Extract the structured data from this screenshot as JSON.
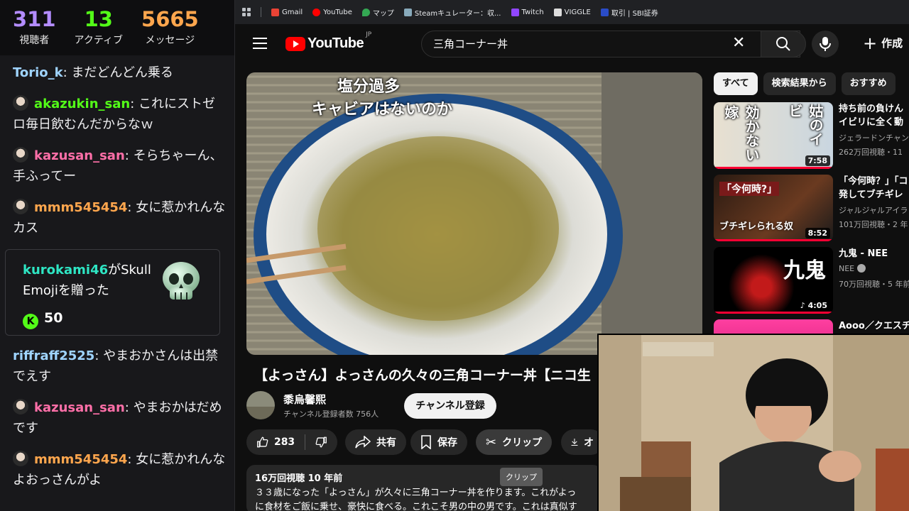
{
  "stream_stats": {
    "viewers": "311",
    "viewers_label": "視聴者",
    "active": "13",
    "active_label": "アクティブ",
    "messages": "5665",
    "messages_label": "メッセージ"
  },
  "chat": {
    "messages": [
      {
        "user": "Torio_k",
        "text": "まだどんどん乗る",
        "color": "#9fd4ff",
        "badge": false
      },
      {
        "user": "akazukin_san",
        "text": "これにストゼロ毎日飲むんだからなｗ",
        "color": "#53fc18",
        "badge": true
      },
      {
        "user": "kazusan_san",
        "text": "そらちゃーん、手ふってー",
        "color": "#ff6fa8",
        "badge": true
      },
      {
        "user": "mmm545454",
        "text": "女に惹かれんなカス",
        "color": "#ffa64d",
        "badge": true
      },
      {
        "user": "riffraff2525",
        "text": "やまおかさんは出禁でえす",
        "color": "#9fd4ff",
        "badge": false
      },
      {
        "user": "kazusan_san",
        "text": "やまおかはだめです",
        "color": "#ff6fa8",
        "badge": true
      },
      {
        "user": "mmm545454",
        "text": "女に惹かれんなよおっさんがよ",
        "color": "#ffa64d",
        "badge": true
      }
    ],
    "gift": {
      "user": "kurokami46",
      "text": "がSkull Emojiを贈った",
      "amount": "50",
      "user_color": "#2ee6c4"
    }
  },
  "bookmarks": [
    {
      "label": "Gmail",
      "color": "#ea4335"
    },
    {
      "label": "YouTube",
      "color": "#ff0000"
    },
    {
      "label": "マップ",
      "color": "#34a853"
    },
    {
      "label": "Steamキュレーター：収...",
      "color": "#9ab"
    },
    {
      "label": "Twitch",
      "color": "#9146ff"
    },
    {
      "label": "VIGGLE",
      "color": "#ddd"
    },
    {
      "label": "取引 | SBI証券",
      "color": "#2a4cc7"
    }
  ],
  "youtube": {
    "logo": "YouTube",
    "region": "JP",
    "search_query": "三角コーナー丼",
    "create_label": "作成",
    "video": {
      "overlay_line1": "塩分過多",
      "overlay_line2": "キャビアはないのか",
      "title": "【よっさん】よっさんの久々の三角コーナー丼【ニコ生",
      "channel": "黍烏馨熙",
      "subscribers": "チャンネル登録者数 756人",
      "subscribe_label": "チャンネル登録",
      "likes": "283",
      "share_label": "共有",
      "save_label": "保存",
      "clip_label": "クリップ",
      "download_label": "オ",
      "tooltip": "クリップ",
      "views_date": "16万回視聴  10 年前",
      "description": "３３歳になった「よっさん」が久々に三角コーナー丼を作ります。これがよっ",
      "description2": "に食材をご飯に乗せ、豪快に食べる。これこそ男の中の男です。これは真似す"
    },
    "chips": [
      "すべて",
      "検索結果から",
      "おすすめ"
    ],
    "recommendations": [
      {
        "title": "持ち前の負けん",
        "title2": "イビリに全く動",
        "channel": "ジェラードンチャン",
        "meta": "262万回視聴・11 ",
        "duration": "7:58",
        "thumb_text": "効かない嫁",
        "thumb_text2": "姑のイビ"
      },
      {
        "title": "「今何時？」「コ",
        "title2": "発してブチギレ",
        "channel": "ジャルジャルアイラ",
        "meta": "101万回視聴・2 年",
        "duration": "8:52",
        "thumb_text": "「今何時?」",
        "thumb_text2": "ブチギレられる奴"
      },
      {
        "title": "九鬼 - NEE",
        "title2": "",
        "channel": "NEE",
        "meta": "70万回視聴・5 年前",
        "duration": "4:05",
        "thumb_text": "九鬼",
        "thumb_text2": ""
      },
      {
        "title": "Aooo／クエスチ",
        "title2": "",
        "channel": "",
        "meta": "",
        "duration": "",
        "thumb_text": "",
        "thumb_text2": ""
      }
    ]
  }
}
